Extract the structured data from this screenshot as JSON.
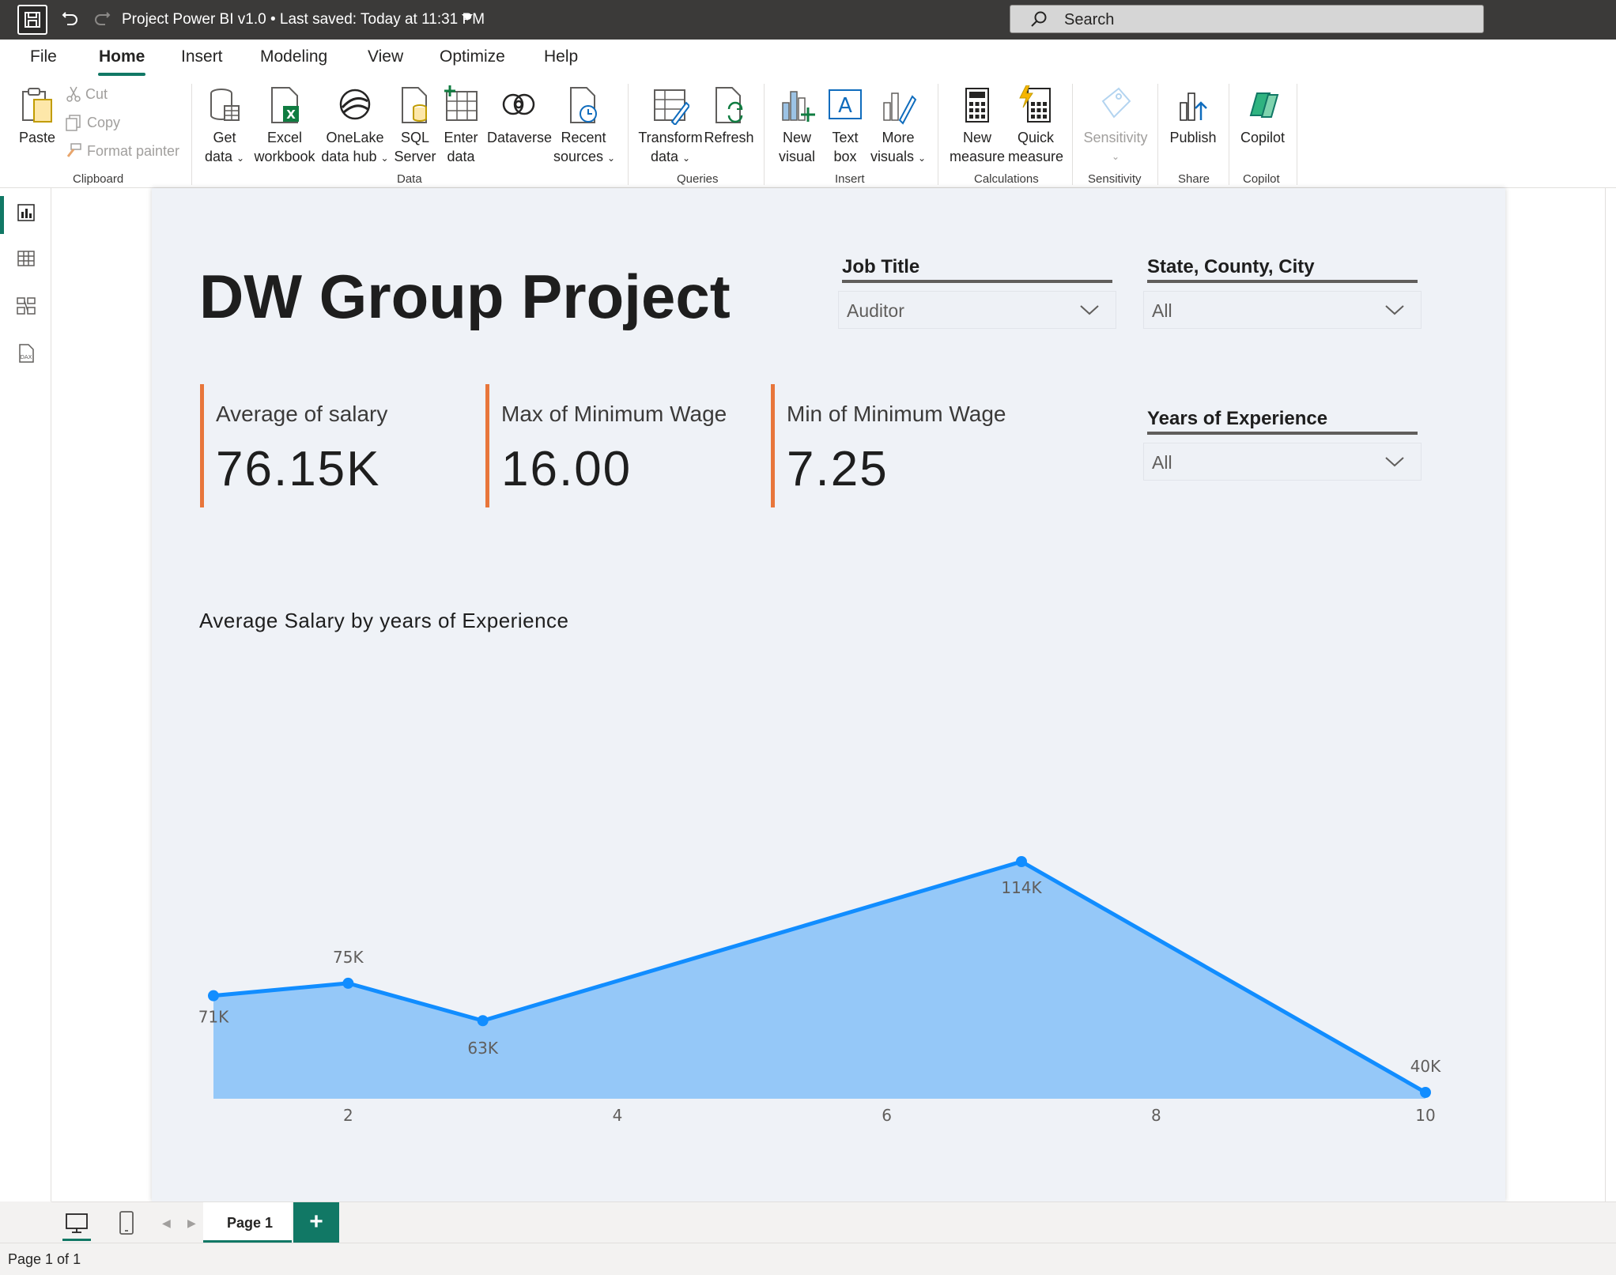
{
  "titlebar": {
    "title": "Project Power BI v1.0 • Last saved: Today at 11:31 PM",
    "search_label": "Search"
  },
  "menu": {
    "tabs": [
      "File",
      "Home",
      "Insert",
      "Modeling",
      "View",
      "Optimize",
      "Help"
    ],
    "active": "Home"
  },
  "ribbon": {
    "paste": "Paste",
    "cut": "Cut",
    "copy": "Copy",
    "format_painter": "Format painter",
    "get_data": [
      "Get",
      "data"
    ],
    "excel": [
      "Excel",
      "workbook"
    ],
    "onelake": [
      "OneLake",
      "data hub"
    ],
    "sql": [
      "SQL",
      "Server"
    ],
    "enter_data": [
      "Enter",
      "data"
    ],
    "dataverse": "Dataverse",
    "recent": [
      "Recent",
      "sources"
    ],
    "transform": [
      "Transform",
      "data"
    ],
    "refresh": "Refresh",
    "new_visual": [
      "New",
      "visual"
    ],
    "text_box": [
      "Text",
      "box"
    ],
    "more_visuals": [
      "More",
      "visuals"
    ],
    "new_measure": [
      "New",
      "measure"
    ],
    "quick_measure": [
      "Quick",
      "measure"
    ],
    "sensitivity": "Sensitivity",
    "publish": "Publish",
    "copilot": "Copilot",
    "groups": {
      "clipboard": "Clipboard",
      "data": "Data",
      "queries": "Queries",
      "insert": "Insert",
      "calculations": "Calculations",
      "sensitivity": "Sensitivity",
      "share": "Share",
      "copilot": "Copilot"
    }
  },
  "report": {
    "title": "DW Group Project",
    "slicers": {
      "job_title": {
        "title": "Job Title",
        "value": "Auditor"
      },
      "location": {
        "title": "State, County, City",
        "value": "All"
      },
      "experience": {
        "title": "Years of Experience",
        "value": "All"
      }
    },
    "cards": [
      {
        "label": "Average of salary",
        "value": "76.15K"
      },
      {
        "label": "Max of Minimum Wage",
        "value": "16.00"
      },
      {
        "label": "Min of Minimum Wage",
        "value": "7.25"
      }
    ],
    "chart_title": "Average Salary by years of Experience"
  },
  "chart_data": {
    "type": "area",
    "title": "Average Salary by years of Experience",
    "x": [
      1,
      2,
      3,
      7,
      10
    ],
    "values": [
      71000,
      75000,
      63000,
      114000,
      40000
    ],
    "data_labels": [
      "71K",
      "75K",
      "63K",
      "114K",
      "40K"
    ],
    "x_ticks": [
      2,
      4,
      6,
      8,
      10
    ],
    "xlim": [
      1,
      10
    ],
    "colors": {
      "line": "#118dff",
      "fill": "#95c8f8"
    }
  },
  "pages": {
    "tab": "Page 1",
    "add": "+",
    "status": "Page 1 of 1"
  },
  "colors": {
    "accent": "#117865",
    "card_bar": "#e8763b"
  }
}
